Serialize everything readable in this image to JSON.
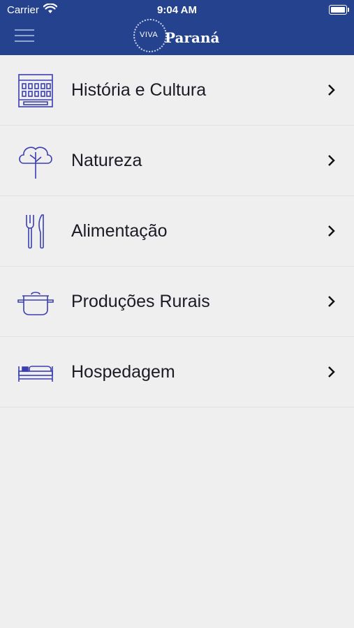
{
  "status_bar": {
    "carrier": "Carrier",
    "time": "9:04 AM"
  },
  "header": {
    "logo_prefix": "VIVA",
    "logo_name": "Paraná"
  },
  "menu": {
    "items": [
      {
        "label": "História e Cultura",
        "icon": "building-icon"
      },
      {
        "label": "Natureza",
        "icon": "tree-icon"
      },
      {
        "label": "Alimentação",
        "icon": "fork-knife-icon"
      },
      {
        "label": "Produções Rurais",
        "icon": "pot-icon"
      },
      {
        "label": "Hospedagem",
        "icon": "bed-icon"
      }
    ]
  },
  "colors": {
    "header": "#25428f",
    "icon_stroke": "#3a3fb1",
    "background": "#efefef"
  }
}
